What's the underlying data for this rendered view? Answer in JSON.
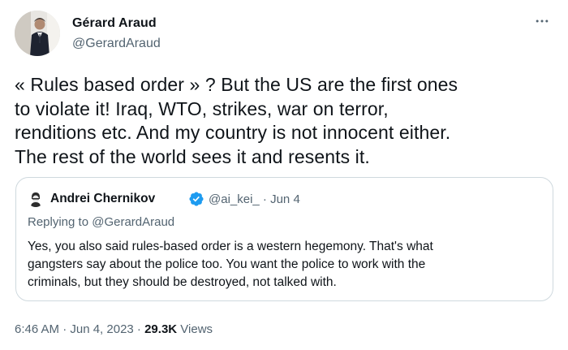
{
  "author": {
    "name": "Gérard Araud",
    "handle": "@GerardAraud"
  },
  "more_icon": "more-horizontal-icon",
  "tweet": {
    "lines": [
      "« Rules based order » ? But the US are the first ones",
      "to violate it! Iraq, WTO, strikes, war on terror,",
      "renditions etc. And my country is not innocent either.",
      "The rest of the world sees it and resents it."
    ]
  },
  "quote": {
    "author_name": "Andrei Chernikov",
    "verified_icon": "verified-badge-icon",
    "handle_date": "@ai_kei_ · Jun 4",
    "replying_to": "Replying to @GerardAraud",
    "lines": [
      "Yes, you also said rules-based order is a western hegemony. That's what",
      "gangsters say about the police too. You want the police to work with the",
      "criminals, but they should be destroyed, not talked with."
    ]
  },
  "meta": {
    "timestamp": "6:46 AM · Jun 4, 2023 · ",
    "views_count": "29.3K",
    "views_label": " Views"
  },
  "colors": {
    "text_primary": "#0f1419",
    "text_secondary": "#536471",
    "border": "#cfd9de",
    "verified_blue": "#1d9bf0"
  }
}
